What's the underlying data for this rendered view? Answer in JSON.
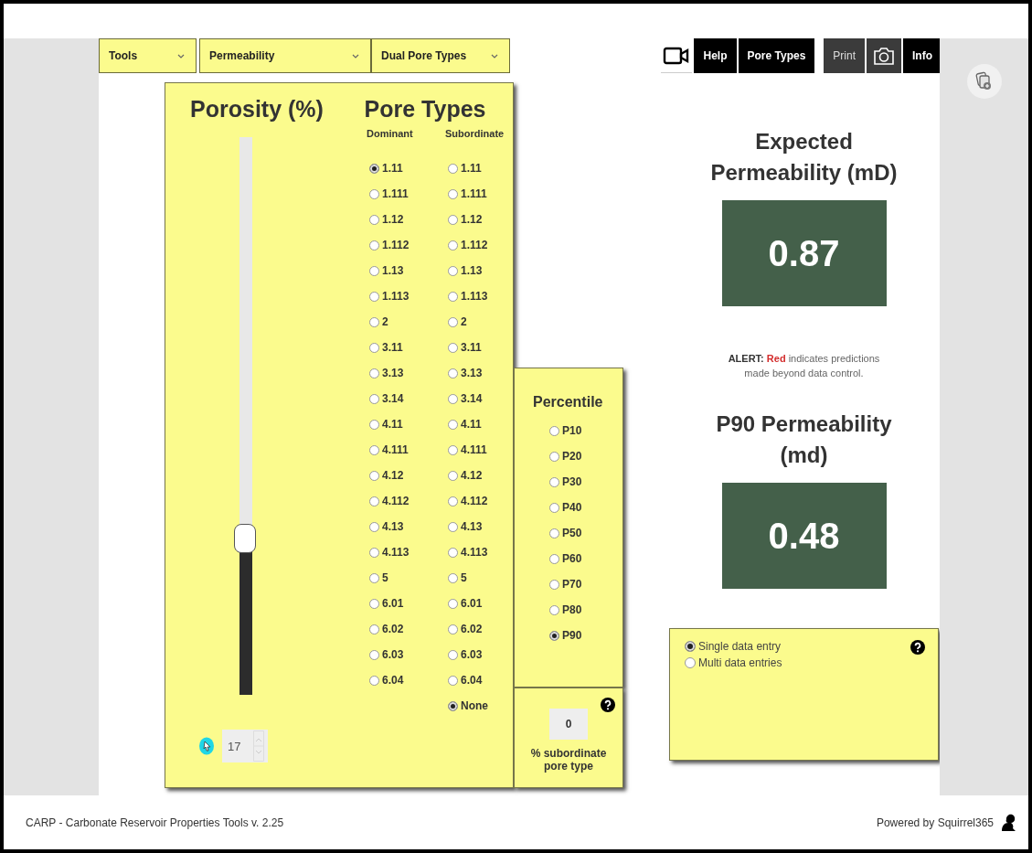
{
  "menus": [
    {
      "label": "Tools"
    },
    {
      "label": "Permeability"
    },
    {
      "label": "Dual Pore Types"
    }
  ],
  "toolbar": [
    {
      "kind": "video",
      "disabled": false
    },
    {
      "kind": "text",
      "label": "Help",
      "disabled": false
    },
    {
      "kind": "text",
      "label": "Pore Types",
      "disabled": false
    },
    {
      "kind": "text",
      "label": "Print",
      "disabled": true
    },
    {
      "kind": "camera",
      "disabled": true
    },
    {
      "kind": "text",
      "label": "Info",
      "disabled": false
    }
  ],
  "porosity": {
    "title": "Porosity (%)",
    "level": 0.28,
    "value": "17"
  },
  "pore_types": {
    "title": "Pore Types",
    "columns": [
      {
        "header": "Dominant",
        "options": [
          {
            "label": "1.11",
            "selected": true
          },
          {
            "label": "1.111",
            "selected": false
          },
          {
            "label": "1.12",
            "selected": false
          },
          {
            "label": "1.112",
            "selected": false
          },
          {
            "label": "1.13",
            "selected": false
          },
          {
            "label": "1.113",
            "selected": false
          },
          {
            "label": "2",
            "selected": false
          },
          {
            "label": "3.11",
            "selected": false
          },
          {
            "label": "3.13",
            "selected": false
          },
          {
            "label": "3.14",
            "selected": false
          },
          {
            "label": "4.11",
            "selected": false
          },
          {
            "label": "4.111",
            "selected": false
          },
          {
            "label": "4.12",
            "selected": false
          },
          {
            "label": "4.112",
            "selected": false
          },
          {
            "label": "4.13",
            "selected": false
          },
          {
            "label": "4.113",
            "selected": false
          },
          {
            "label": "5",
            "selected": false
          },
          {
            "label": "6.01",
            "selected": false
          },
          {
            "label": "6.02",
            "selected": false
          },
          {
            "label": "6.03",
            "selected": false
          },
          {
            "label": "6.04",
            "selected": false
          }
        ]
      },
      {
        "header": "Subordinate",
        "options": [
          {
            "label": "1.11",
            "selected": false
          },
          {
            "label": "1.111",
            "selected": false
          },
          {
            "label": "1.12",
            "selected": false
          },
          {
            "label": "1.112",
            "selected": false
          },
          {
            "label": "1.13",
            "selected": false
          },
          {
            "label": "1.113",
            "selected": false
          },
          {
            "label": "2",
            "selected": false
          },
          {
            "label": "3.11",
            "selected": false
          },
          {
            "label": "3.13",
            "selected": false
          },
          {
            "label": "3.14",
            "selected": false
          },
          {
            "label": "4.11",
            "selected": false
          },
          {
            "label": "4.111",
            "selected": false
          },
          {
            "label": "4.12",
            "selected": false
          },
          {
            "label": "4.112",
            "selected": false
          },
          {
            "label": "4.13",
            "selected": false
          },
          {
            "label": "4.113",
            "selected": false
          },
          {
            "label": "5",
            "selected": false
          },
          {
            "label": "6.01",
            "selected": false
          },
          {
            "label": "6.02",
            "selected": false
          },
          {
            "label": "6.03",
            "selected": false
          },
          {
            "label": "6.04",
            "selected": false
          },
          {
            "label": "None",
            "selected": true
          }
        ]
      }
    ]
  },
  "percentile": {
    "title": "Percentile",
    "options": [
      {
        "label": "P10",
        "selected": false
      },
      {
        "label": "P20",
        "selected": false
      },
      {
        "label": "P30",
        "selected": false
      },
      {
        "label": "P40",
        "selected": false
      },
      {
        "label": "P50",
        "selected": false
      },
      {
        "label": "P60",
        "selected": false
      },
      {
        "label": "P70",
        "selected": false
      },
      {
        "label": "P80",
        "selected": false
      },
      {
        "label": "P90",
        "selected": true
      }
    ]
  },
  "subordinate_percent": {
    "value": "0",
    "label": "% subordinate pore type"
  },
  "expected": {
    "title": "Expected Permeability (mD)",
    "value": "0.87"
  },
  "alert": {
    "label": "ALERT:",
    "highlight": "Red",
    "text": "indicates predictions made beyond data control."
  },
  "p90": {
    "title": "P90 Permeability (md)",
    "value": "0.48"
  },
  "entry_mode": {
    "options": [
      {
        "label": "Single data entry",
        "selected": true
      },
      {
        "label": "Multi data entries",
        "selected": false
      }
    ]
  },
  "footer": {
    "left": "CARP - Carbonate Reservoir Properties Tools v. 2.25",
    "right": "Powered by Squirrel365"
  }
}
